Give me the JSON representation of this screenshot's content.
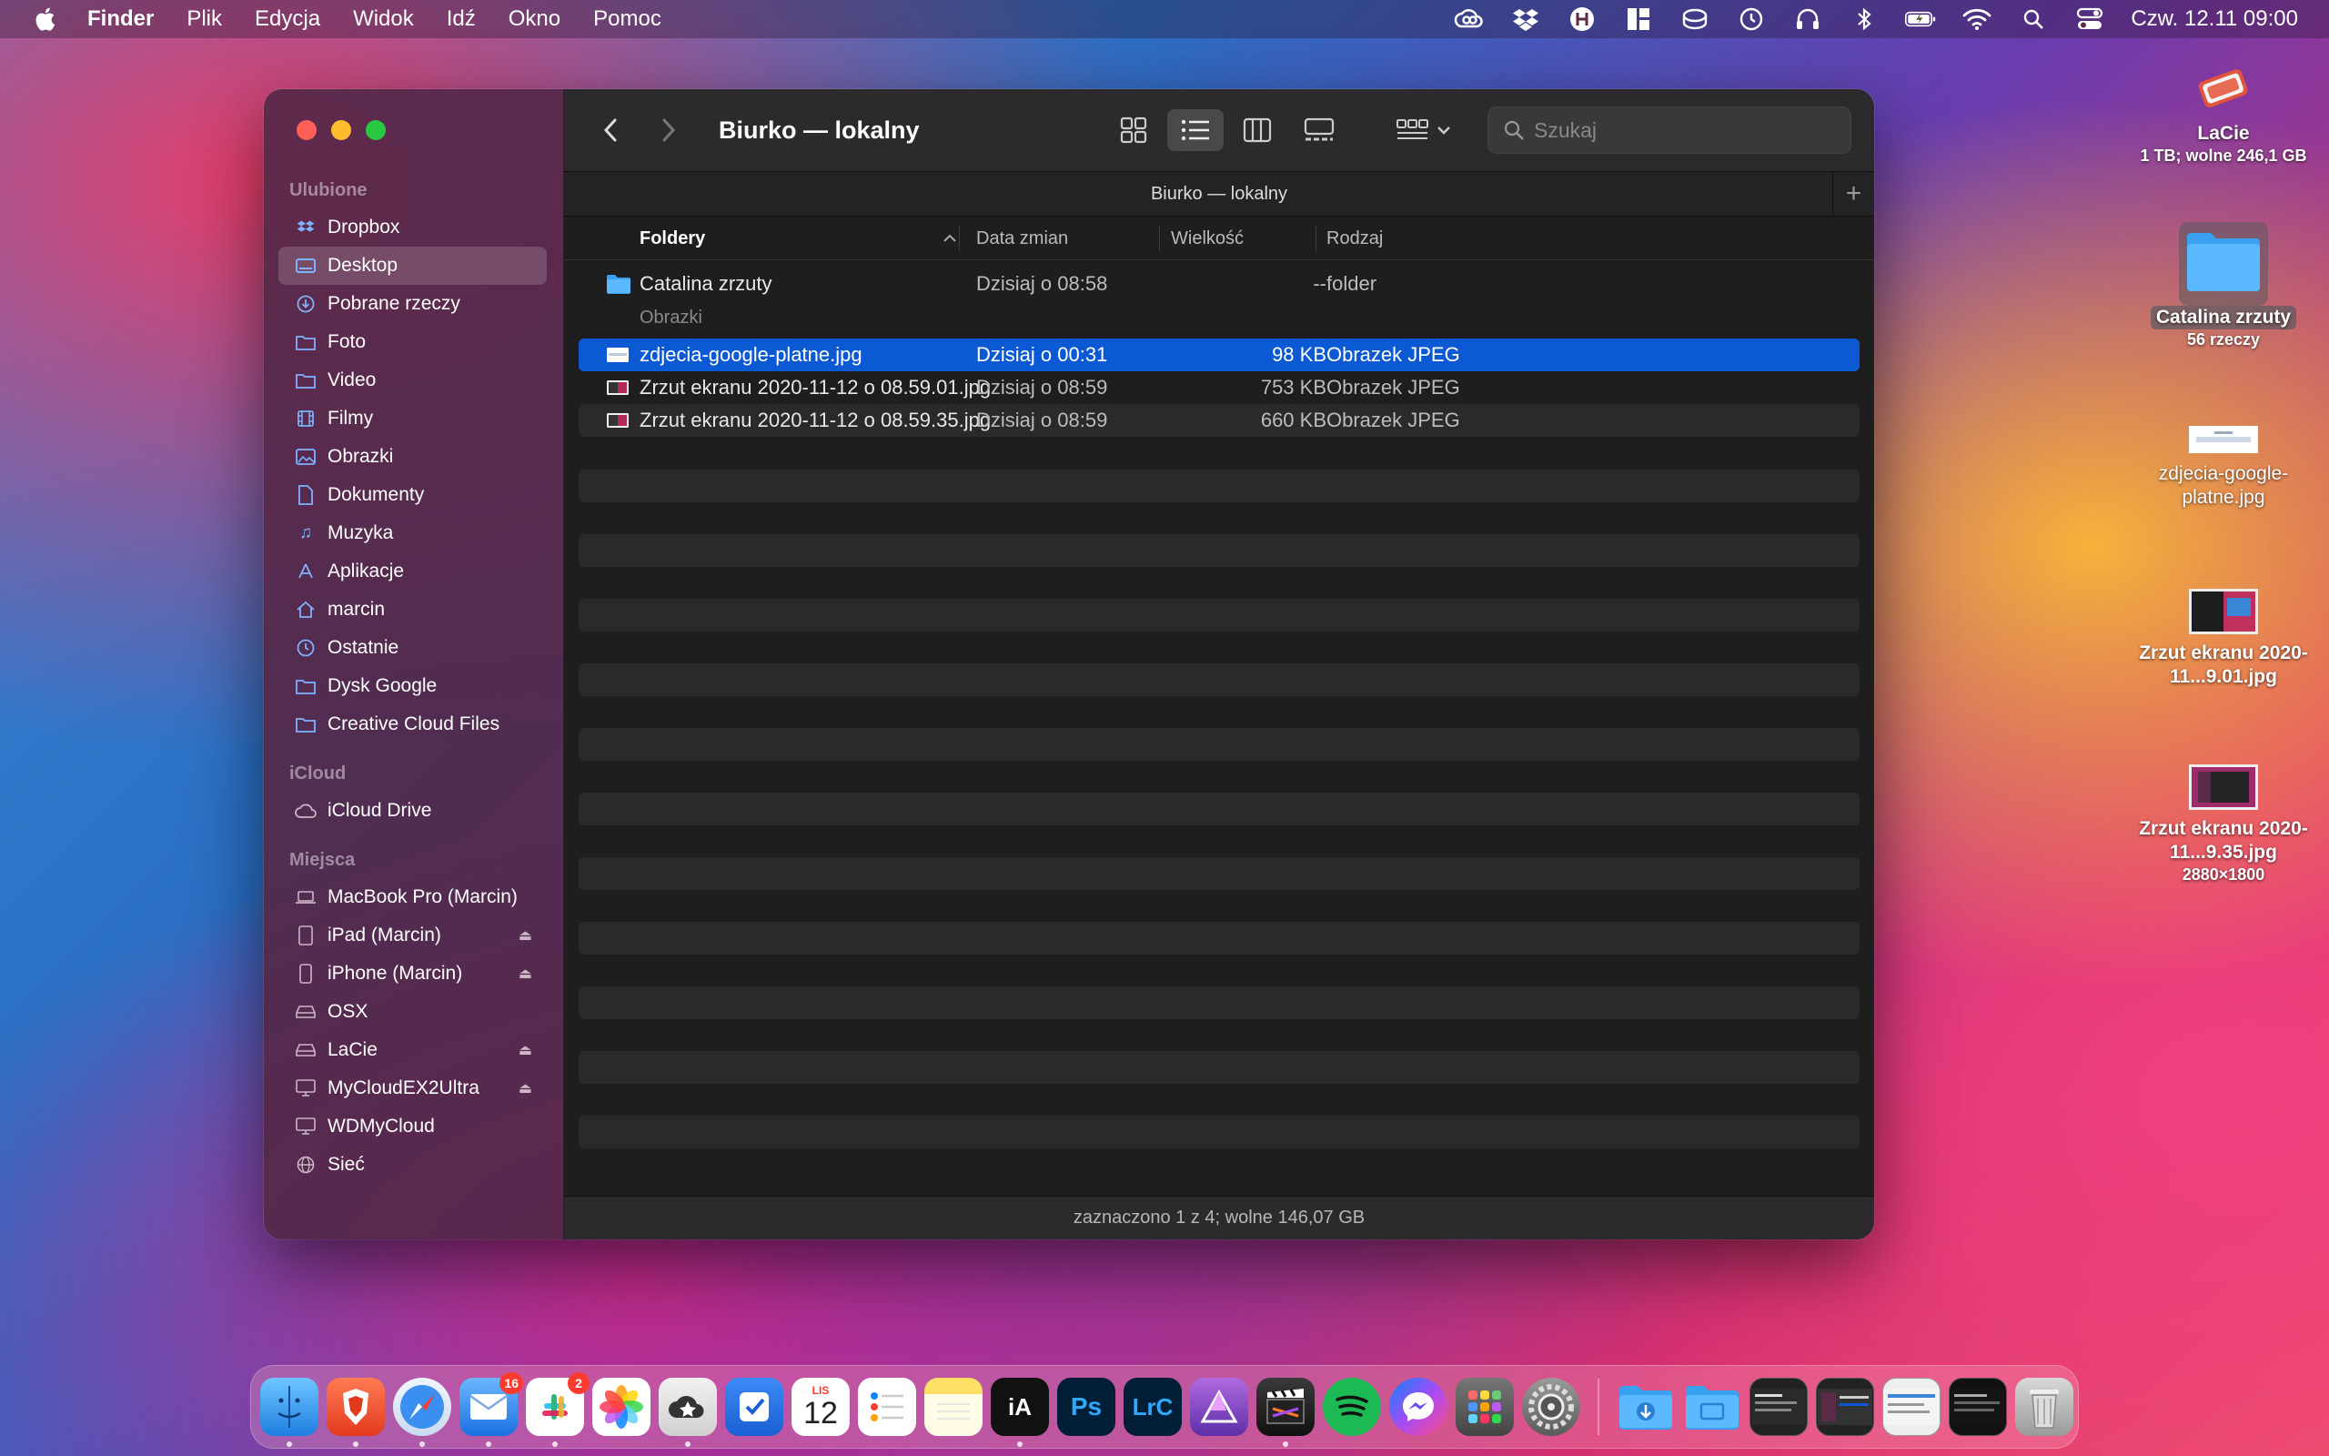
{
  "menubar": {
    "app_name": "Finder",
    "menus": [
      "Plik",
      "Edycja",
      "Widok",
      "Idź",
      "Okno",
      "Pomoc"
    ],
    "clock": "Czw. 12.11  09:00"
  },
  "window": {
    "title": "Biurko — lokalny",
    "tab_label": "Biurko — lokalny",
    "search_placeholder": "Szukaj",
    "status": "zaznaczono 1 z 4; wolne 146,07 GB"
  },
  "sidebar": {
    "favorites_header": "Ulubione",
    "favorites": [
      {
        "label": "Dropbox",
        "icon": "dropbox-icon"
      },
      {
        "label": "Desktop",
        "icon": "desktop-icon",
        "active": true
      },
      {
        "label": "Pobrane rzeczy",
        "icon": "download-icon"
      },
      {
        "label": "Foto",
        "icon": "folder-icon"
      },
      {
        "label": "Video",
        "icon": "folder-icon"
      },
      {
        "label": "Filmy",
        "icon": "film-icon"
      },
      {
        "label": "Obrazki",
        "icon": "photo-icon"
      },
      {
        "label": "Dokumenty",
        "icon": "document-icon"
      },
      {
        "label": "Muzyka",
        "icon": "music-icon"
      },
      {
        "label": "Aplikacje",
        "icon": "apps-icon"
      },
      {
        "label": "marcin",
        "icon": "home-icon"
      },
      {
        "label": "Ostatnie",
        "icon": "clock-icon"
      },
      {
        "label": "Dysk Google",
        "icon": "folder-icon"
      },
      {
        "label": "Creative Cloud Files",
        "icon": "folder-icon"
      }
    ],
    "icloud_header": "iCloud",
    "icloud": [
      {
        "label": "iCloud Drive",
        "icon": "cloud-icon"
      }
    ],
    "places_header": "Miejsca",
    "places": [
      {
        "label": "MacBook Pro (Marcin)",
        "icon": "laptop-icon",
        "eject": false
      },
      {
        "label": "iPad (Marcin)",
        "icon": "ipad-icon",
        "eject": true
      },
      {
        "label": "iPhone (Marcin)",
        "icon": "iphone-icon",
        "eject": true
      },
      {
        "label": "OSX",
        "icon": "disk-icon",
        "eject": false
      },
      {
        "label": "LaCie",
        "icon": "disk-icon",
        "eject": true
      },
      {
        "label": "MyCloudEX2Ultra",
        "icon": "display-icon",
        "eject": true
      },
      {
        "label": "WDMyCloud",
        "icon": "display-icon",
        "eject": false
      },
      {
        "label": "Sieć",
        "icon": "globe-icon",
        "eject": false
      }
    ]
  },
  "columns": {
    "name": "Foldery",
    "date": "Data zmian",
    "size": "Wielkość",
    "kind": "Rodzaj"
  },
  "group_folders_row": {
    "name": "Catalina zrzuty",
    "date": "Dzisiaj o 08:58",
    "size": "--",
    "kind": "folder"
  },
  "group_images_label": "Obrazki",
  "files": [
    {
      "name": "zdjecia-google-platne.jpg",
      "date": "Dzisiaj o 00:31",
      "size": "98 KB",
      "kind": "Obrazek JPEG",
      "selected": true
    },
    {
      "name": "Zrzut ekranu 2020-11-12 o 08.59.01.jpg",
      "date": "Dzisiaj o 08:59",
      "size": "753 KB",
      "kind": "Obrazek JPEG",
      "selected": false
    },
    {
      "name": "Zrzut ekranu 2020-11-12 o 08.59.35.jpg",
      "date": "Dzisiaj o 08:59",
      "size": "660 KB",
      "kind": "Obrazek JPEG",
      "selected": false
    }
  ],
  "desktop_icons": [
    {
      "label": "LaCie",
      "sub": "1 TB; wolne 246,1 GB"
    },
    {
      "label": "Catalina zrzuty",
      "sub": "56 rzeczy"
    },
    {
      "label": "zdjecia-google-platne.jpg",
      "sub": ""
    },
    {
      "label": "Zrzut ekranu 2020-11...9.01.jpg",
      "sub": ""
    },
    {
      "label": "Zrzut ekranu 2020-11...9.35.jpg",
      "sub": "2880×1800"
    }
  ],
  "dock": {
    "mail_badge": "16",
    "slack_badge": "2",
    "calendar_month": "LIS",
    "calendar_day": "12",
    "ia_writer_label": "iA",
    "photoshop_label": "Ps",
    "lightroom_label": "LrC"
  },
  "colors": {
    "selection": "#0c59d4",
    "sidebar": "#542848",
    "accent_icon": "#7fb2ff"
  }
}
